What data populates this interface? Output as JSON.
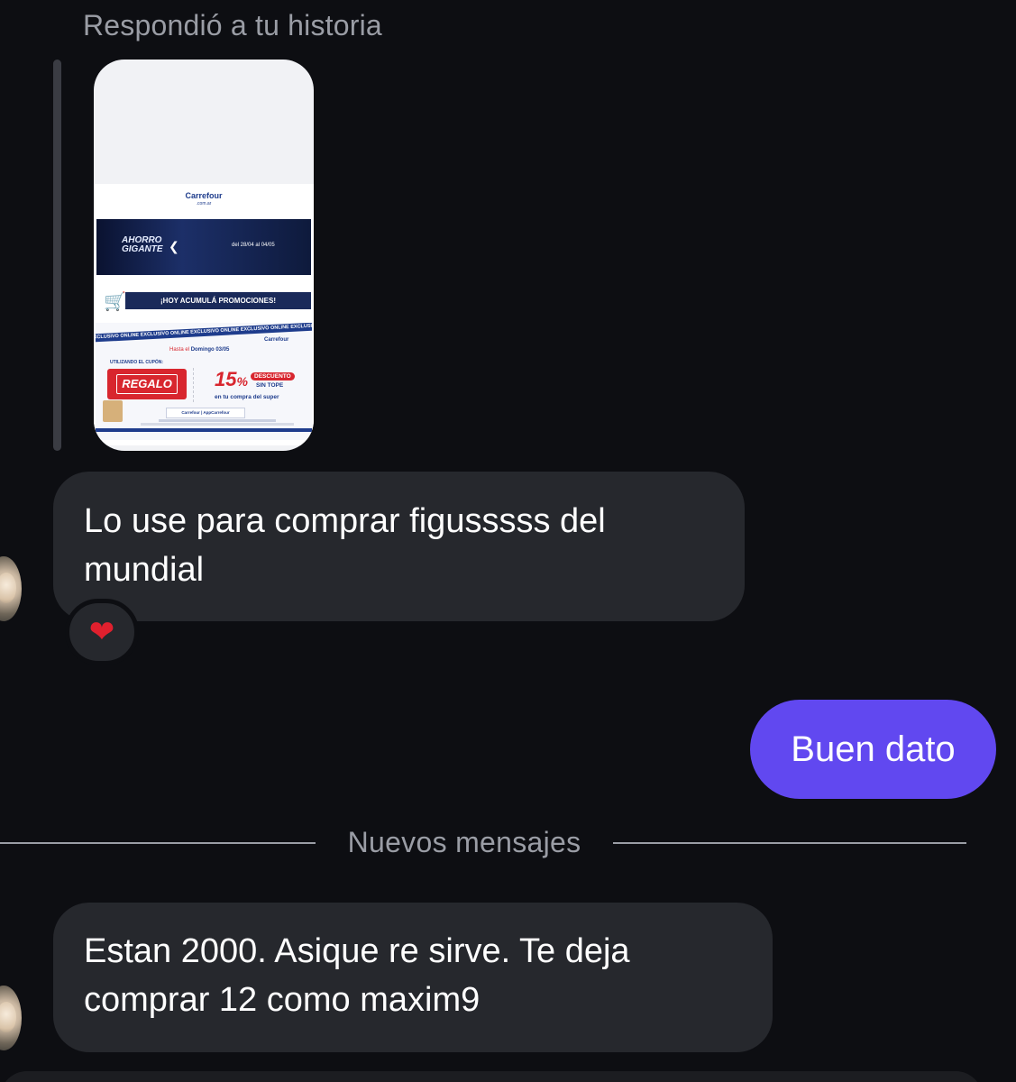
{
  "reply_caption": "Respondió a tu historia",
  "story": {
    "brand": "Carrefour",
    "brand_domain": ".com.ar",
    "banner_title_line1": "AHORRO",
    "banner_title_line2": "GIGANTE",
    "banner_dates": "del 28/04 al 04/05",
    "cart_text": "¡HOY ACUMULÁ PROMOCIONES!",
    "ribbon_text": "EXCLUSIVO ONLINE  EXCLUSIVO ONLINE  EXCLUSIVO ONLINE  EXCLUSIVO ONLINE  EXCLUSIVO ONLINE",
    "until_prefix": "Hasta el",
    "until_day": "Domingo 03/05",
    "using_coupon": "UTILIZANDO EL CUPÓN:",
    "gift_label": "REGALO",
    "percent": "15",
    "percent_sign": "%",
    "discount_label": "DESCUENTO",
    "no_cap_label": "SIN TOPE",
    "purchase_label": "en tu compra del super",
    "logos_text": "Carrefour  |  AppCarrefour"
  },
  "messages": {
    "incoming_1": "Lo use para comprar figusssss del mundial",
    "reaction_1": "❤",
    "outgoing_1": "Buen dato",
    "incoming_2": "Estan 2000. Asique re sirve. Te deja comprar 12 como maxim9"
  },
  "divider_label": "Nuevos mensajes",
  "colors": {
    "background": "#0d0e12",
    "incoming_bubble": "#26282d",
    "outgoing_bubble": "#6148f0",
    "muted_text": "#9a9da5"
  }
}
